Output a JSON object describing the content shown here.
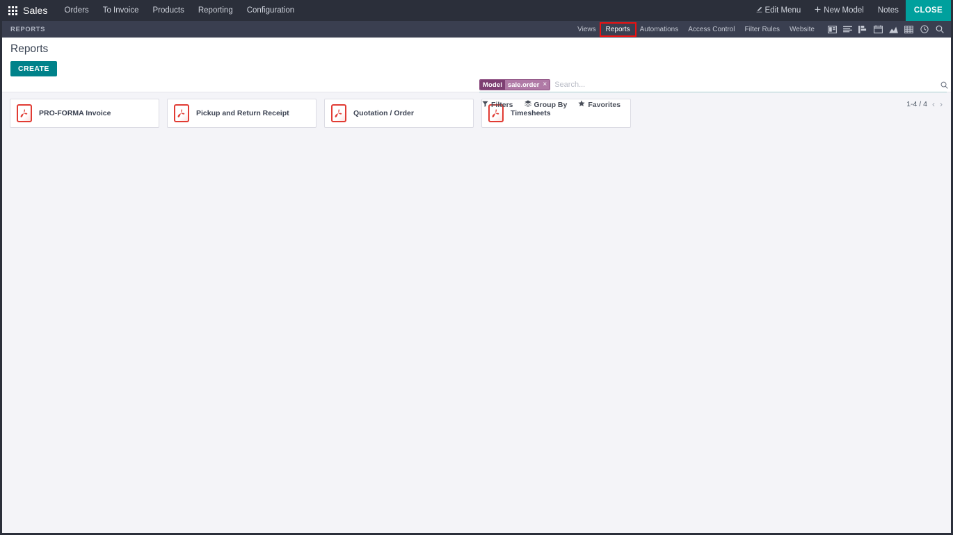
{
  "navbar": {
    "apps_icon": "apps-grid-icon",
    "brand": "Sales",
    "menu": [
      {
        "label": "Orders"
      },
      {
        "label": "To Invoice"
      },
      {
        "label": "Products"
      },
      {
        "label": "Reporting"
      },
      {
        "label": "Configuration"
      }
    ],
    "right": [
      {
        "label": "Edit Menu",
        "icon": "pencil-icon"
      },
      {
        "label": "New Model",
        "icon": "plus-icon"
      },
      {
        "label": "Notes",
        "icon": ""
      }
    ],
    "close_label": "CLOSE",
    "accent_color": "#00a09d",
    "background_color": "#2b2f3a"
  },
  "subbar": {
    "title": "REPORTS",
    "tabs": [
      {
        "label": "Views",
        "highlighted": false
      },
      {
        "label": "Reports",
        "highlighted": true
      },
      {
        "label": "Automations",
        "highlighted": false
      },
      {
        "label": "Access Control",
        "highlighted": false
      },
      {
        "label": "Filter Rules",
        "highlighted": false
      },
      {
        "label": "Website",
        "highlighted": false
      }
    ],
    "view_icons": [
      "kanban-view-icon",
      "list-view-icon",
      "gantt-view-icon",
      "calendar-view-icon",
      "graph-view-icon",
      "pivot-view-icon",
      "activity-view-icon",
      "search-view-icon"
    ],
    "highlight_color": "#ee1111",
    "background_color": "#3a3f50"
  },
  "control_panel": {
    "title": "Reports",
    "create_label": "CREATE",
    "create_color": "#00828a",
    "search": {
      "facet_label": "Model",
      "facet_value": "sale.order",
      "facet_remove": "×",
      "placeholder": "Search...",
      "value": "",
      "facet_label_color": "#7d3f72",
      "facet_value_color": "#b07aa6",
      "toggle_icon": "search-icon"
    },
    "filters": [
      {
        "label": "Filters",
        "icon": "funnel-icon"
      },
      {
        "label": "Group By",
        "icon": "layers-icon"
      },
      {
        "label": "Favorites",
        "icon": "star-icon"
      }
    ],
    "pager": {
      "range": "1-4 / 4",
      "previous_icon": "chevron-left-icon",
      "next_icon": "chevron-right-icon"
    }
  },
  "kanban": {
    "cards": [
      {
        "title": "PRO-FORMA Invoice",
        "icon": "pdf-file-icon"
      },
      {
        "title": "Pickup and Return Receipt",
        "icon": "pdf-file-icon"
      },
      {
        "title": "Quotation / Order",
        "icon": "pdf-file-icon"
      },
      {
        "title": "Timesheets",
        "icon": "pdf-file-icon"
      }
    ],
    "icon_color": "#e13b33",
    "background_color": "#f4f4f8"
  }
}
